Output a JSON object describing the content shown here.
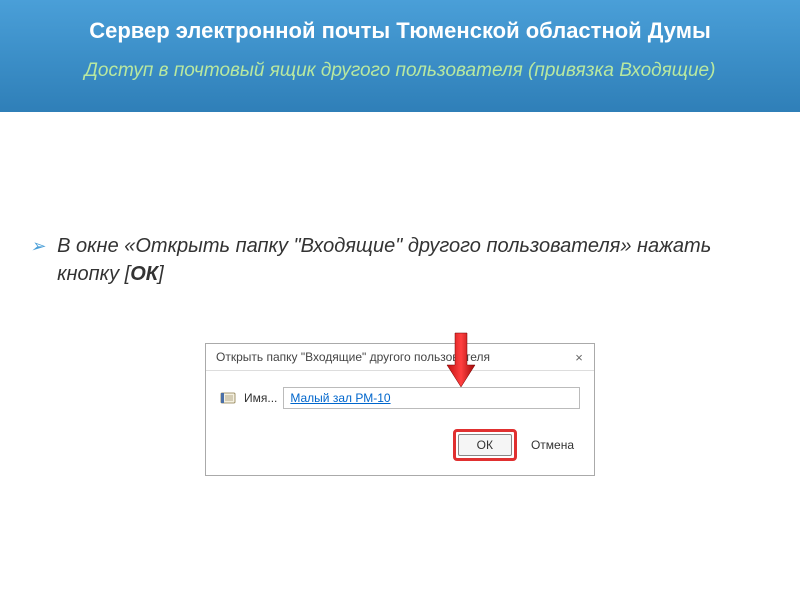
{
  "header": {
    "title": "Сервер электронной почты Тюменской областной Думы",
    "subtitle": "Доступ в почтовый ящик другого пользователя (привязка Входящие)"
  },
  "instruction": {
    "prefix": "В окне «",
    "dialog_name": "Открыть папку \"Входящие\" другого пользователя",
    "middle": "» нажать кнопку [",
    "button_name": "ОК",
    "suffix": "]"
  },
  "dialog": {
    "title": "Открыть папку \"Входящие\" другого пользователя",
    "close_glyph": "×",
    "name_label": "Имя...",
    "name_value": "Малый зал РМ-10",
    "ok_label": "ОК",
    "cancel_label": "Отмена"
  }
}
